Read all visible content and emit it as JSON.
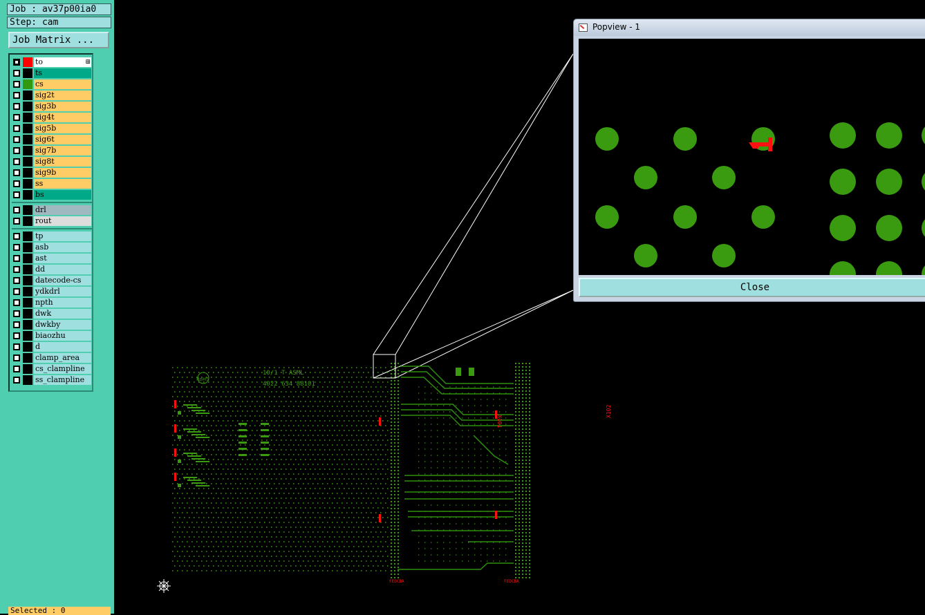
{
  "job_label": "Job : av37p00ia0",
  "step_label": "Step: cam",
  "job_matrix_button": "Job Matrix ...",
  "layers": [
    {
      "name": "to",
      "bg": "#ffffff",
      "color": "#ff0000",
      "checked": true,
      "expand": true
    },
    {
      "name": "ts",
      "bg": "#00aa88",
      "color": "#000000",
      "checked": false
    },
    {
      "name": "cs",
      "bg": "#ffcc66",
      "color": "#339911",
      "checked": false
    },
    {
      "name": "sig2t",
      "bg": "#ffcc66",
      "color": "#000000",
      "checked": false
    },
    {
      "name": "sig3b",
      "bg": "#ffcc66",
      "color": "#000000",
      "checked": false
    },
    {
      "name": "sig4t",
      "bg": "#ffcc66",
      "color": "#000000",
      "checked": false
    },
    {
      "name": "sig5b",
      "bg": "#ffcc66",
      "color": "#000000",
      "checked": false
    },
    {
      "name": "sig6t",
      "bg": "#ffcc66",
      "color": "#000000",
      "checked": false
    },
    {
      "name": "sig7b",
      "bg": "#ffcc66",
      "color": "#000000",
      "checked": false
    },
    {
      "name": "sig8t",
      "bg": "#ffcc66",
      "color": "#000000",
      "checked": false
    },
    {
      "name": "sig9b",
      "bg": "#ffcc66",
      "color": "#000000",
      "checked": false
    },
    {
      "name": "ss",
      "bg": "#ffcc66",
      "color": "#000000",
      "checked": false
    },
    {
      "name": "bs",
      "bg": "#00aa88",
      "color": "#000000",
      "checked": false
    },
    {
      "name": "drl",
      "bg": "#a0b8c0",
      "color": "#000000",
      "checked": false,
      "group_start": true
    },
    {
      "name": "rout",
      "bg": "#dddddd",
      "color": "#000000",
      "checked": false
    },
    {
      "name": "tp",
      "bg": "#9fdfdf",
      "color": "#000000",
      "checked": false,
      "group_start": true
    },
    {
      "name": "asb",
      "bg": "#9fdfdf",
      "color": "#000000",
      "checked": false
    },
    {
      "name": "ast",
      "bg": "#9fdfdf",
      "color": "#000000",
      "checked": false
    },
    {
      "name": "dd",
      "bg": "#9fdfdf",
      "color": "#000000",
      "checked": false
    },
    {
      "name": "datecode-cs",
      "bg": "#9fdfdf",
      "color": "#000000",
      "checked": false
    },
    {
      "name": "ydkdrl",
      "bg": "#9fdfdf",
      "color": "#000000",
      "checked": false
    },
    {
      "name": "npth",
      "bg": "#9fdfdf",
      "color": "#000000",
      "checked": false
    },
    {
      "name": "dwk",
      "bg": "#9fdfdf",
      "color": "#000000",
      "checked": false
    },
    {
      "name": "dwkby",
      "bg": "#9fdfdf",
      "color": "#000000",
      "checked": false
    },
    {
      "name": "biaozhu",
      "bg": "#9fdfdf",
      "color": "#000000",
      "checked": false
    },
    {
      "name": "d",
      "bg": "#9fdfdf",
      "color": "#000000",
      "checked": false
    },
    {
      "name": "clamp_area",
      "bg": "#9fdfdf",
      "color": "#000000",
      "checked": false
    },
    {
      "name": "cs_clampline",
      "bg": "#9fdfdf",
      "color": "#000000",
      "checked": false
    },
    {
      "name": "ss_clampline",
      "bg": "#9fdfdf",
      "color": "#000000",
      "checked": false
    }
  ],
  "selected_label": "Selected : 0",
  "popview": {
    "title": "Popview - 1",
    "close_label": "Close"
  },
  "board_text": {
    "code_line1": "10/1  T  ASML",
    "code_line2": "4022 634 88101",
    "rohs": "RoHS",
    "connector_left": "X101",
    "connector_right": "X102",
    "pin_row_left": "FEDCBA",
    "pin_row_right": "FEDCBA"
  },
  "colors": {
    "pad_green": "#3a9a10",
    "trace_green": "#2f8f0f",
    "marker_red": "#ff1010",
    "panel_teal": "#4fcfaf"
  }
}
